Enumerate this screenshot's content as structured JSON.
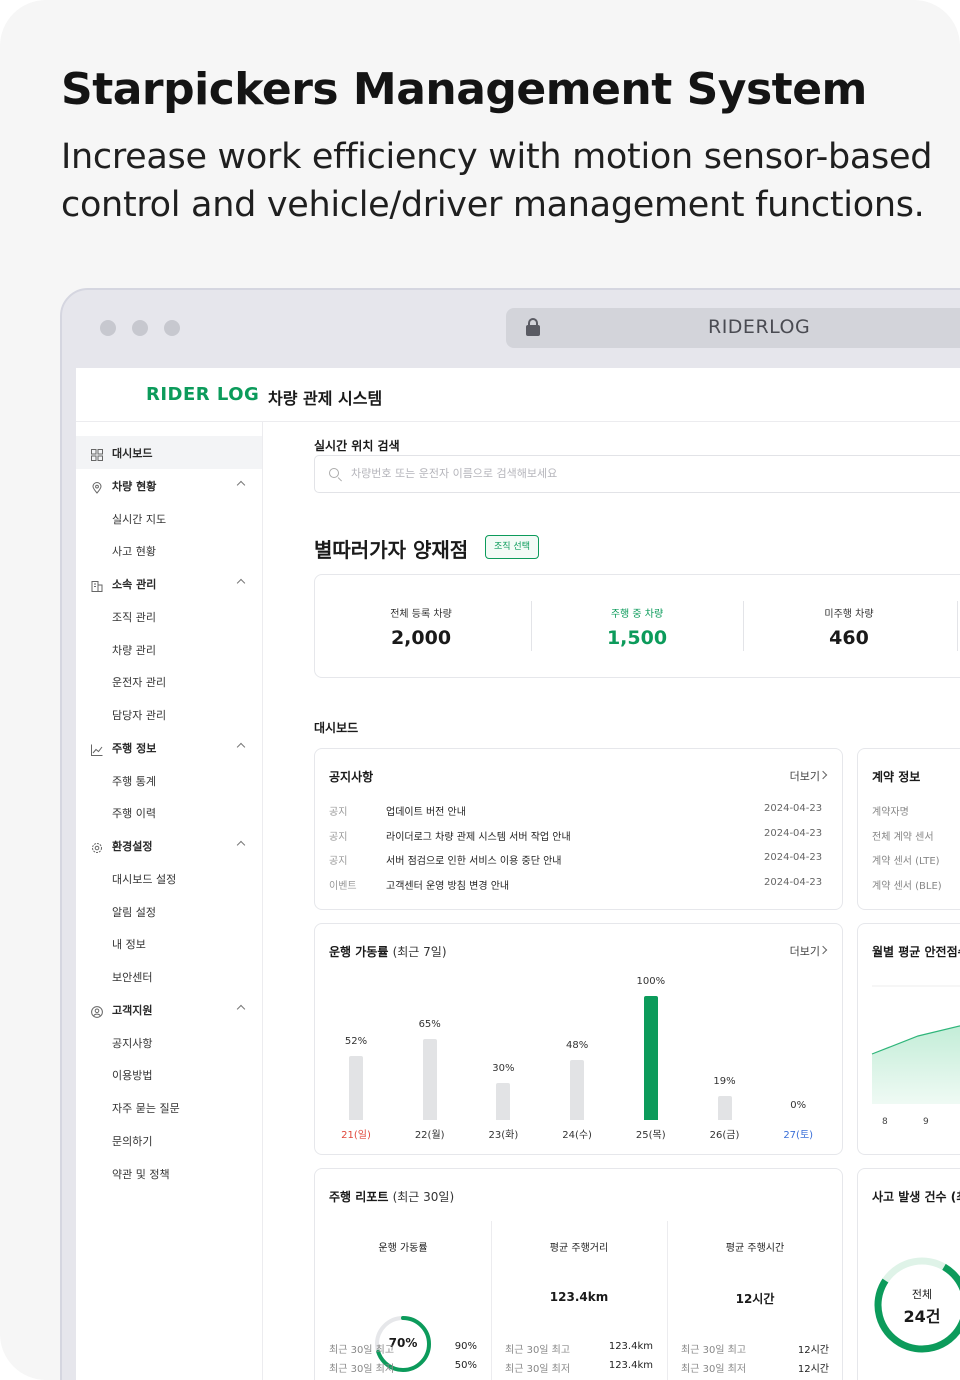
{
  "hero": {
    "title": "Starpickers Management System",
    "subtitle": "Increase work efficiency with motion sensor-based control and vehicle/driver management functions."
  },
  "browser": {
    "url_text": "RIDERLOG"
  },
  "app": {
    "logo": "RIDER LOG",
    "title": "차량 관제 시스템"
  },
  "sidebar": {
    "items": [
      {
        "label": "대시보드",
        "level": "top",
        "icon": "grid-icon",
        "active": true
      },
      {
        "label": "차량 현황",
        "level": "top",
        "icon": "location-pin-icon",
        "expanded": true
      },
      {
        "label": "실시간 지도",
        "level": "sub"
      },
      {
        "label": "사고 현황",
        "level": "sub"
      },
      {
        "label": "소속 관리",
        "level": "top",
        "icon": "building-icon",
        "expanded": true
      },
      {
        "label": "조직 관리",
        "level": "sub"
      },
      {
        "label": "차량 관리",
        "level": "sub"
      },
      {
        "label": "운전자 관리",
        "level": "sub"
      },
      {
        "label": "담당자 관리",
        "level": "sub"
      },
      {
        "label": "주행 정보",
        "level": "top",
        "icon": "line-chart-icon",
        "expanded": true
      },
      {
        "label": "주행 통계",
        "level": "sub"
      },
      {
        "label": "주행 이력",
        "level": "sub"
      },
      {
        "label": "환경설정",
        "level": "top",
        "icon": "gear-icon",
        "expanded": true
      },
      {
        "label": "대시보드 설정",
        "level": "sub"
      },
      {
        "label": "알림 설정",
        "level": "sub"
      },
      {
        "label": "내 정보",
        "level": "sub"
      },
      {
        "label": "보안센터",
        "level": "sub"
      },
      {
        "label": "고객지원",
        "level": "top",
        "icon": "user-circle-icon",
        "expanded": true
      },
      {
        "label": "공지사항",
        "level": "sub"
      },
      {
        "label": "이용방법",
        "level": "sub"
      },
      {
        "label": "자주 묻는 질문",
        "level": "sub"
      },
      {
        "label": "문의하기",
        "level": "sub"
      },
      {
        "label": "약관 및 정책",
        "level": "sub"
      }
    ]
  },
  "search": {
    "label": "실시간 위치 검색",
    "placeholder": "차량번호 또는 운전자 이름으로 검색해보세요",
    "value": ""
  },
  "org": {
    "name": "별따러가자 양재점",
    "select_label": "조직 선택"
  },
  "stats": [
    {
      "label": "전체 등록 차량",
      "value": "2,000"
    },
    {
      "label": "주행 중 차량",
      "value": "1,500",
      "highlight": true
    },
    {
      "label": "미주행 차량",
      "value": "460"
    }
  ],
  "dashboard": {
    "label": "대시보드",
    "notice": {
      "title": "공지사항",
      "more": "더보기",
      "rows": [
        {
          "type": "공지",
          "text": "업데이트 버전 안내",
          "date": "2024-04-23"
        },
        {
          "type": "공지",
          "text": "라이더로그 차량 관제 시스템 서버 작업 안내",
          "date": "2024-04-23"
        },
        {
          "type": "공지",
          "text": "서버 점검으로 인한 서비스 이용 중단 안내",
          "date": "2024-04-23"
        },
        {
          "type": "이벤트",
          "text": "고객센터 운영 방침 변경 안내",
          "date": "2024-04-23"
        }
      ]
    },
    "contract": {
      "title": "계약 정보",
      "rows": [
        "계약자명",
        "전체 계약 센서",
        "계약 센서 (LTE)",
        "계약 센서 (BLE)"
      ]
    },
    "operation": {
      "title": "운행 가동률",
      "title_suffix": "(최근 7일)",
      "more": "더보기"
    },
    "safety": {
      "title": "월별 평균 안전점수",
      "x_ticks": [
        "8",
        "9"
      ]
    },
    "report": {
      "title": "주행 리포트",
      "title_suffix": "(최근 30일)",
      "columns": [
        {
          "label": "운행 가동률",
          "value": "70%",
          "percent": 70,
          "max_label": "최근 30일 최고",
          "max": "90%",
          "min_label": "최근 30일 최저",
          "min": "50%"
        },
        {
          "label": "평균 주행거리",
          "value": "123.4km",
          "max_label": "최근 30일 최고",
          "max": "123.4km",
          "min_label": "최근 30일 최저",
          "min": "123.4km"
        },
        {
          "label": "평균 주행시간",
          "value": "12시간",
          "max_label": "최근 30일 최고",
          "max": "12시간",
          "min_label": "최근 30일 최저",
          "min": "12시간"
        }
      ]
    },
    "accident": {
      "title": "사고 발생 건수 (최",
      "center_label": "전체",
      "center_value": "24건"
    }
  },
  "chart_data": {
    "type": "bar",
    "categories": [
      "21(일)",
      "22(월)",
      "23(화)",
      "24(수)",
      "25(목)",
      "26(금)",
      "27(토)"
    ],
    "values": [
      52,
      65,
      30,
      48,
      100,
      19,
      0
    ],
    "value_labels": [
      "52%",
      "65%",
      "30%",
      "48%",
      "100%",
      "19%",
      "0%"
    ],
    "highlight_index": 4,
    "ylim": [
      0,
      100
    ],
    "colors": {
      "bar": "#e2e3e5",
      "highlight": "#0c9b5b",
      "sunday": "#e0483c",
      "saturday": "#3a6fd8"
    }
  },
  "colors": {
    "accent": "#0c9b5b"
  }
}
